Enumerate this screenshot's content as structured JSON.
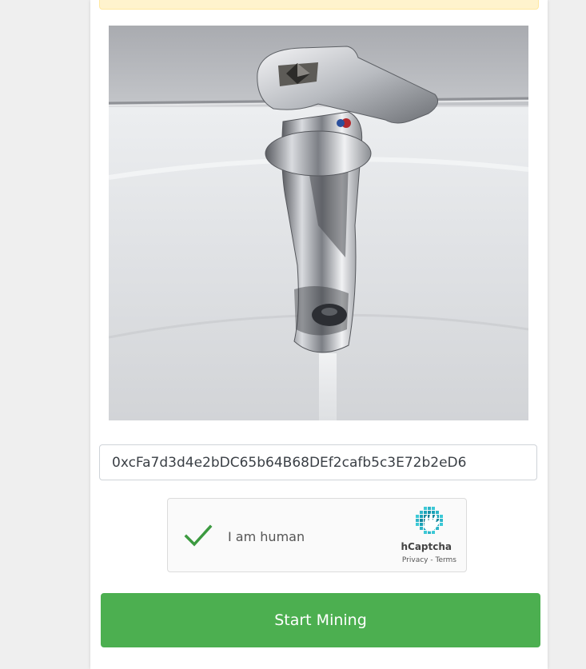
{
  "faucet": {
    "wallet_address": "0xcFa7d3d4e2bDC65b64B68DEf2cafb5c3E72b2eD6",
    "start_button_label": "Start Mining"
  },
  "captcha": {
    "label": "I am human",
    "brand": "hCaptcha",
    "privacy_link": "Privacy",
    "separator": " - ",
    "terms_link": "Terms",
    "checked": true
  },
  "icons": {
    "hero": "faucet-photo-icon",
    "check": "checkmark-icon",
    "captcha_logo": "hcaptcha-logo-icon"
  },
  "colors": {
    "button": "#4caf50",
    "check": "#3c9a40",
    "alert_background": "#fff3cd"
  }
}
